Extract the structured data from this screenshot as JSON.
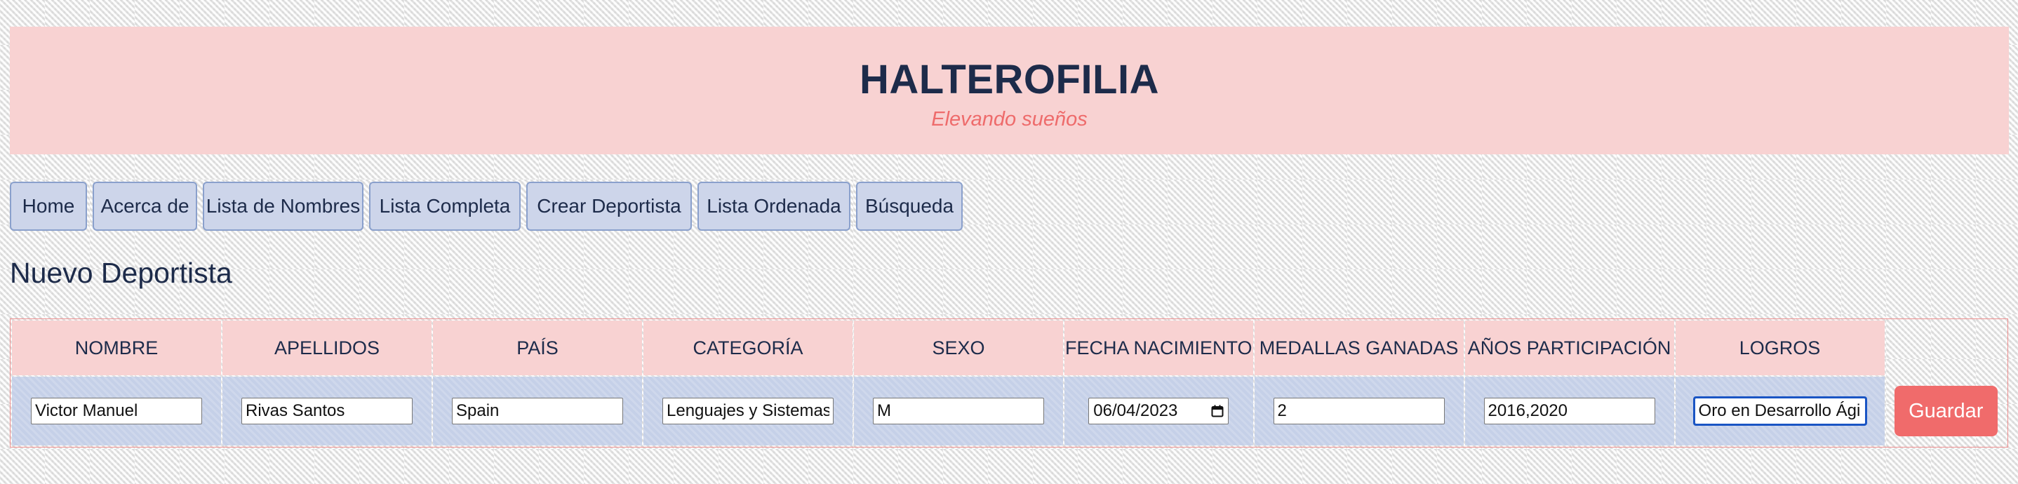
{
  "header": {
    "title": "HALTEROFILIA",
    "subtitle": "Elevando sueños"
  },
  "nav": {
    "items": [
      {
        "label": "Home"
      },
      {
        "label": "Acerca de"
      },
      {
        "label": "Lista de Nombres"
      },
      {
        "label": "Lista Completa"
      },
      {
        "label": "Crear Deportista"
      },
      {
        "label": "Lista Ordenada"
      },
      {
        "label": "Búsqueda"
      }
    ]
  },
  "page": {
    "title": "Nuevo Deportista"
  },
  "form": {
    "columns": [
      "NOMBRE",
      "APELLIDOS",
      "PAÍS",
      "CATEGORÍA",
      "SEXO",
      "FECHA NACIMIENTO",
      "MEDALLAS GANADAS",
      "AÑOS PARTICIPACIÓN",
      "LOGROS"
    ],
    "values": {
      "nombre": "Victor Manuel",
      "apellidos": "Rivas Santos",
      "pais": "Spain",
      "categoria": "Lenguajes y Sistemas In",
      "sexo": "M",
      "fecha_nacimiento": "06/04/2023",
      "medallas": "2",
      "anios": "2016,2020",
      "logros": "Oro en Desarrollo Ágil"
    },
    "save_label": "Guardar"
  },
  "colors": {
    "header_bg": "#f8d2d2",
    "subtitle": "#ee6b6b",
    "nav_bg": "#cdd5ea",
    "row_bg": "#c5d0e8",
    "save_button": "#f06b6b",
    "text": "#1d2b4a"
  },
  "icons": {
    "date_picker": "calendar-icon"
  }
}
